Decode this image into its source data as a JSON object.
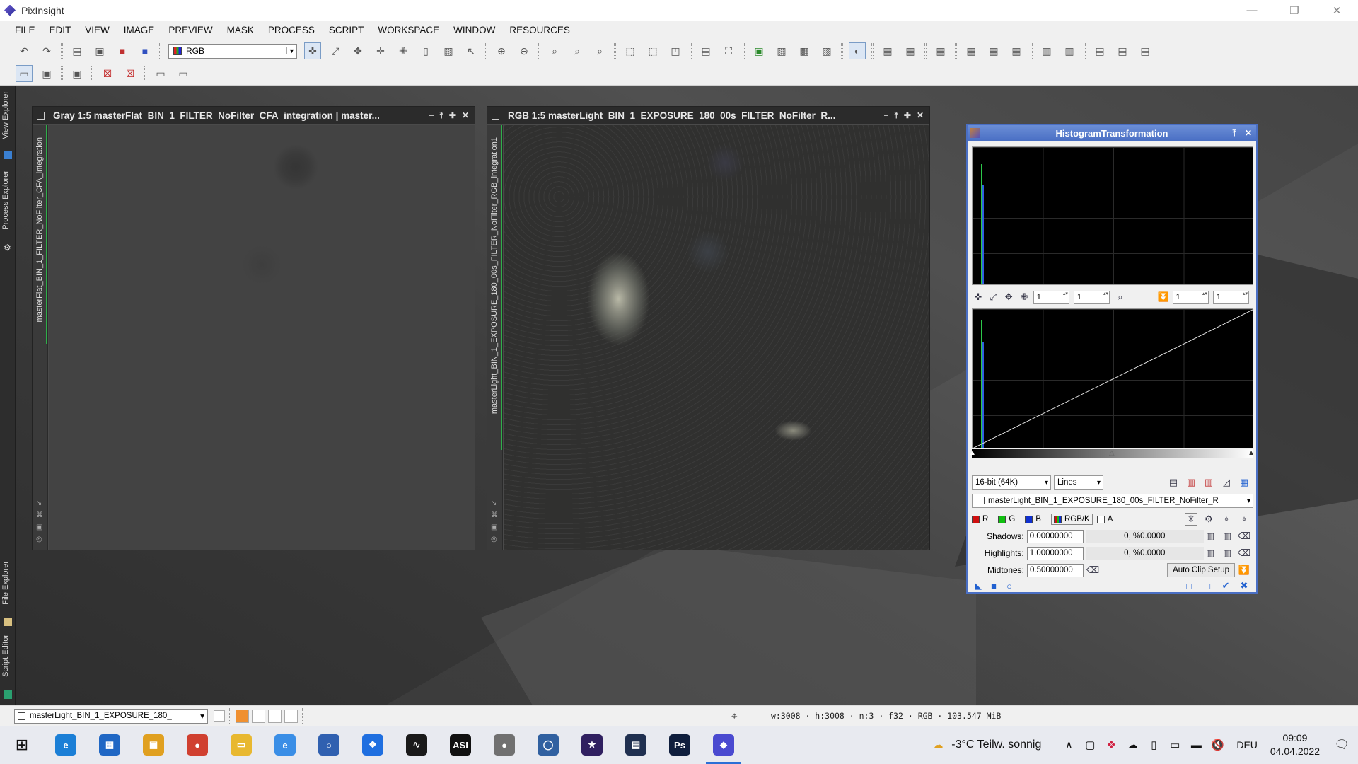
{
  "app": {
    "title": "PixInsight"
  },
  "window_controls": {
    "minimize": "—",
    "restore": "❐",
    "close": "✕"
  },
  "menu": [
    "FILE",
    "EDIT",
    "VIEW",
    "IMAGE",
    "PREVIEW",
    "MASK",
    "PROCESS",
    "SCRIPT",
    "WORKSPACE",
    "WINDOW",
    "RESOURCES"
  ],
  "toolbar": {
    "channel_select": "RGB"
  },
  "left_panel": {
    "tabs": [
      "View Explorer",
      "Process Explorer",
      "File Explorer",
      "Script Editor"
    ]
  },
  "windows": {
    "gray": {
      "title": "Gray 1:5 masterFlat_BIN_1_FILTER_NoFilter_CFA_integration | master...",
      "side_label": "masterFlat_BIN_1_FILTER_NoFilter_CFA_integration"
    },
    "rgb": {
      "title": "RGB 1:5 masterLight_BIN_1_EXPOSURE_180_00s_FILTER_NoFilter_R...",
      "side_label": "masterLight_BIN_1_EXPOSURE_180_00s_FILTER_NoFilter_RGB_integration1"
    }
  },
  "histogram": {
    "title": "HistogramTransformation",
    "zoom_fields": [
      "1",
      "1",
      "1",
      "1"
    ],
    "resolution": "16-bit (64K)",
    "graph_style": "Lines",
    "view": "masterLight_BIN_1_EXPOSURE_180_00s_FILTER_NoFilter_R",
    "channels": [
      {
        "label": "R",
        "color": "#d01010"
      },
      {
        "label": "G",
        "color": "#10c010"
      },
      {
        "label": "B",
        "color": "#1030d0"
      },
      {
        "label": "RGB/K",
        "color": "#888888"
      },
      {
        "label": "A",
        "color": "#ffffff"
      }
    ],
    "shadows_label": "Shadows:",
    "shadows": "0.00000000",
    "shadows_clip": "0, %0.0000",
    "highlights_label": "Highlights:",
    "highlights": "1.00000000",
    "highlights_clip": "0, %0.0000",
    "midtones_label": "Midtones:",
    "midtones": "0.50000000",
    "auto_clip": "Auto Clip Setup"
  },
  "status": {
    "view_select": "masterLight_BIN_1_EXPOSURE_180_",
    "info": "w:3008 · h:3008 · n:3 · f32 · RGB · 103.547 MiB"
  },
  "taskbar": {
    "apps": [
      {
        "name": "edge",
        "label": "e",
        "color": "#1b7fd6"
      },
      {
        "name": "store",
        "label": "▦",
        "color": "#2067c4"
      },
      {
        "name": "app-yellow",
        "label": "▣",
        "color": "#e0a020"
      },
      {
        "name": "chrome",
        "label": "●",
        "color": "#d04030"
      },
      {
        "name": "explorer",
        "label": "▭",
        "color": "#e8b830"
      },
      {
        "name": "ie",
        "label": "e",
        "color": "#3a8ee6"
      },
      {
        "name": "app-blue-round",
        "label": "○",
        "color": "#3060b0"
      },
      {
        "name": "dropbox",
        "label": "❖",
        "color": "#1f6fe0"
      },
      {
        "name": "app-red-curve",
        "label": "∿",
        "color": "#1a1a1a"
      },
      {
        "name": "asi",
        "label": "ASI",
        "color": "#111111"
      },
      {
        "name": "app-sphere",
        "label": "●",
        "color": "#707070"
      },
      {
        "name": "app-orbit",
        "label": "◯",
        "color": "#3060a0"
      },
      {
        "name": "app-galaxy",
        "label": "★",
        "color": "#302060"
      },
      {
        "name": "app-image",
        "label": "▤",
        "color": "#203050"
      },
      {
        "name": "photoshop",
        "label": "Ps",
        "color": "#0f1e3d"
      },
      {
        "name": "pixinsight",
        "label": "◆",
        "color": "#4a4ad0"
      }
    ],
    "weather": "-3°C  Teilw. sonnig",
    "language": "DEU",
    "time": "09:09",
    "date": "04.04.2022"
  }
}
